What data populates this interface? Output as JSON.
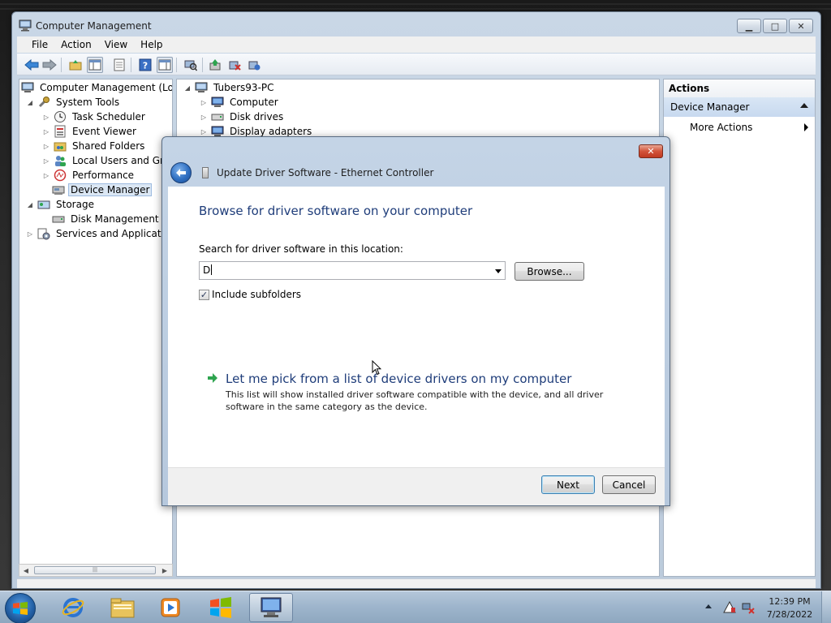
{
  "window": {
    "title": "Computer Management",
    "controls": {
      "minimize": "▁",
      "maximize": "□",
      "close": "✕"
    }
  },
  "menu": [
    "File",
    "Action",
    "View",
    "Help"
  ],
  "tree": {
    "root": "Computer Management (Local",
    "system_tools": "System Tools",
    "task_scheduler": "Task Scheduler",
    "event_viewer": "Event Viewer",
    "shared_folders": "Shared Folders",
    "local_users": "Local Users and Group",
    "performance": "Performance",
    "device_manager": "Device Manager",
    "storage": "Storage",
    "disk_management": "Disk Management",
    "services": "Services and Applications",
    "scroll_thumb_grip": "|||"
  },
  "devices": {
    "pc_name": "Tubers93-PC",
    "computer": "Computer",
    "disk_drives": "Disk drives",
    "display_adapters": "Display adapters"
  },
  "actions": {
    "header": "Actions",
    "group": "Device Manager",
    "more": "More Actions"
  },
  "dialog": {
    "close_label": "✕",
    "title": "Update Driver Software - Ethernet Controller",
    "heading": "Browse for driver software on your computer",
    "search_label": "Search for driver software in this location:",
    "path_value": "D",
    "browse_button": "Browse...",
    "include_subfolders_label": "Include subfolders",
    "include_subfolders_checked": true,
    "check_glyph": "✓",
    "pick_link_title": "Let me pick from a list of device drivers on my computer",
    "pick_link_desc": "This list will show installed driver software compatible with the device, and all driver software in the same category as the device.",
    "next_button": "Next",
    "cancel_button": "Cancel"
  },
  "taskbar": {
    "apps": [
      "internet-explorer",
      "windows-explorer",
      "media-player",
      "windows-update",
      "computer-management"
    ],
    "clock_time": "12:39 PM",
    "clock_date": "7/28/2022"
  },
  "colors": {
    "dialog_heading": "#1f3d7a",
    "link_arrow": "#2ea44f",
    "close_red": "#c9432b",
    "selection": "#dbe7f4"
  }
}
